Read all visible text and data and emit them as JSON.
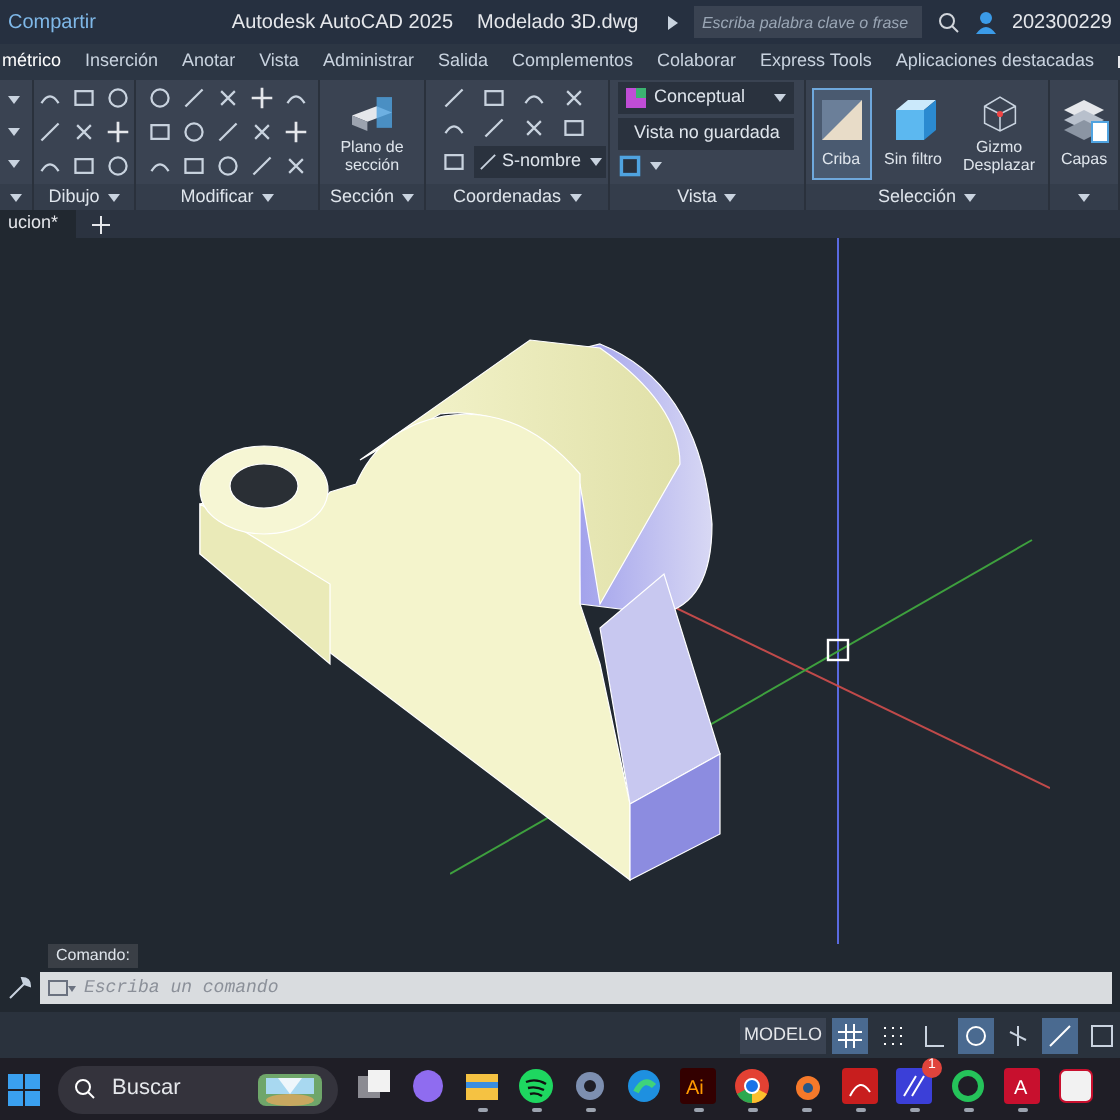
{
  "title_bar": {
    "share": "Compartir",
    "app": "Autodesk AutoCAD 2025",
    "file": "Modelado 3D.dwg",
    "search": {
      "placeholder": "Escriba palabra clave o frase"
    },
    "user": "202300229"
  },
  "menu_tabs": [
    {
      "label": "métrico",
      "selected": true
    },
    {
      "label": "Inserción",
      "selected": false
    },
    {
      "label": "Anotar",
      "selected": false
    },
    {
      "label": "Vista",
      "selected": false
    },
    {
      "label": "Administrar",
      "selected": false
    },
    {
      "label": "Salida",
      "selected": false
    },
    {
      "label": "Complementos",
      "selected": false
    },
    {
      "label": "Colaborar",
      "selected": false
    },
    {
      "label": "Express Tools",
      "selected": false
    },
    {
      "label": "Aplicaciones destacadas",
      "selected": false
    }
  ],
  "ribbon": {
    "panels": [
      {
        "kind": "edge"
      },
      {
        "kind": "draw",
        "title": "Dibujo"
      },
      {
        "kind": "modify",
        "title": "Modificar"
      },
      {
        "kind": "big",
        "title": "Sección",
        "buttons": [
          {
            "kind": "plane",
            "label": "Plano de sección",
            "selected": false
          }
        ]
      },
      {
        "kind": "coords",
        "title": "Coordenadas",
        "dropdown": "S-nombre"
      },
      {
        "kind": "view",
        "title": "Vista",
        "visual_style": "Conceptual",
        "named_view": "Vista no guardada"
      },
      {
        "kind": "big",
        "title": "Selección",
        "buttons": [
          {
            "kind": "cull",
            "label": "Criba",
            "selected": true
          },
          {
            "kind": "filter",
            "label": "Sin filtro",
            "selected": false
          },
          {
            "kind": "gizmo",
            "label": "Gizmo Desplazar",
            "selected": false
          }
        ]
      },
      {
        "kind": "big",
        "buttons": [
          {
            "kind": "layers",
            "label": "Capas",
            "selected": false
          }
        ]
      }
    ]
  },
  "file_tabs": [
    {
      "label": "ucion*",
      "selected": true
    }
  ],
  "command": {
    "label": "Comando:",
    "placeholder": "Escriba un comando"
  },
  "status_bar": {
    "mode": "MODELO",
    "toggles": [
      {
        "kind": "grid",
        "on": true
      },
      {
        "kind": "snap",
        "on": false
      },
      {
        "kind": "ortho",
        "on": false
      },
      {
        "kind": "polar",
        "on": true
      },
      {
        "kind": "iso",
        "on": false
      },
      {
        "kind": "osnap",
        "on": true
      },
      {
        "kind": "frame",
        "on": false
      }
    ]
  },
  "taskbar": {
    "search": "Buscar",
    "apps": [
      {
        "kind": "taskview",
        "running": false
      },
      {
        "kind": "copilot",
        "running": false
      },
      {
        "kind": "folder",
        "running": true
      },
      {
        "kind": "spotify",
        "running": true
      },
      {
        "kind": "gear",
        "running": true
      },
      {
        "kind": "edge",
        "running": false
      },
      {
        "kind": "ai",
        "label": "Ai",
        "running": true
      },
      {
        "kind": "chrome",
        "running": true
      },
      {
        "kind": "blender",
        "running": true
      },
      {
        "kind": "pdf",
        "running": true
      },
      {
        "kind": "pen",
        "badge": "1",
        "running": true
      },
      {
        "kind": "chat",
        "running": true
      },
      {
        "kind": "cad",
        "label": "A",
        "running": true
      },
      {
        "kind": "partial",
        "running": false
      }
    ]
  }
}
